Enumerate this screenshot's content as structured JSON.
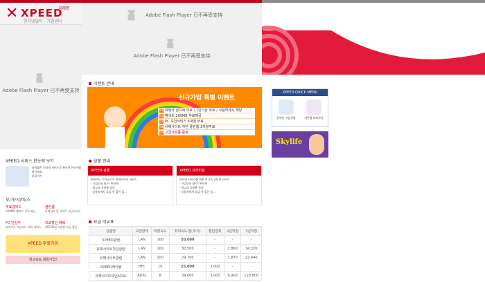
{
  "logo": {
    "brand": "XPEED",
    "badge": "국제증",
    "sub": "인터넷멀티 · 기업센터"
  },
  "flash": {
    "msg": "Adobe Flash Player 已不再受支持"
  },
  "sections": {
    "event": "이벤트 안내",
    "products": "상품 안내",
    "compare": "요금 비교표"
  },
  "event": {
    "headline": "신규가입 특별 이벤트",
    "items": [
      {
        "n": "01",
        "t": "여행사 설치에 무료 / 1인이상 무료 / 사용하게시 해당"
      },
      {
        "n": "02",
        "t": "평생도 200MB 무료제공"
      },
      {
        "n": "03",
        "t": "PC 보안서비스 6개월 무료"
      },
      {
        "n": "04",
        "t": "유해사이트 차단 클린웹 1개월무료"
      },
      {
        "n": "05",
        "t": "고급사은품 증정"
      }
    ]
  },
  "quick": {
    "title": "XPEED QUICK MENU",
    "a": "온라인 가입신청",
    "b": "사은품 보러가기"
  },
  "promo": {
    "label": "Skylife"
  },
  "leftmenu": {
    "title": "XPEED 서비스 한눈에 보기",
    "more": "바로가기",
    "desc": "파워풀한 인터넷 서비스로 편하게 인터넷을 즐기세요",
    "category": "부/가/서/비/스",
    "items": [
      {
        "t": "무료웹하드",
        "d": "200MB 웹하드 무료 제공"
      },
      {
        "t": "클린웹",
        "d": "유해정보 및 사이트 차단서비스"
      },
      {
        "t": "PC 안심지",
        "d": "바이러스 악성코드 치료 서비스"
      },
      {
        "t": "프로할인 혜택",
        "d": "XPEED와 다양한 요금 할인"
      }
    ],
    "banner1": "XPEED 무료가입",
    "banner2": "최고속도 회원가입!"
  },
  "products": [
    {
      "name": "XPEED 광랜",
      "desc": "최대속도 기가급으로 최대인터넷 서비스",
      "b1": "- 기업인의 필수! 편하게",
      "b2": "- 최고급 사용율 증정",
      "b3": "- 사용자에서 요금 약 할인 등..."
    },
    {
      "name": "XPEED 프리미엄",
      "desc": "인터넷 서비스를 위한 최고속 인터넷 서비스",
      "b1": "- 기업인의 필수! 편하게",
      "b2": "- 최고급 사용율 증정",
      "b3": "- 사용자에서 요금 약 할인 등..."
    }
  ],
  "table": {
    "headers": [
      "상품명",
      "모뎀형태",
      "하향속도",
      "최대속도(월,부가)",
      "통합결제",
      "2년약정",
      "3년약정"
    ],
    "rows": [
      [
        "XPEED광랜",
        "LAN",
        "100",
        "20,000",
        "-",
        "-",
        "-"
      ],
      [
        "유해사이트차단광랜",
        "LAN",
        "100",
        "30,500",
        "-",
        "2,860",
        "34,320"
      ],
      [
        "유해사이트광랜",
        "LAN",
        "100",
        "29,700",
        "-",
        "1,870",
        "22,440"
      ],
      [
        "XPEED케이블",
        "HFC",
        "10",
        "25,000",
        "3,000",
        "-",
        "-"
      ],
      [
        "유해사이트차단ADSL",
        "ADSL",
        "8",
        "34,000",
        "3,000",
        "9,900",
        "118,800"
      ]
    ]
  }
}
